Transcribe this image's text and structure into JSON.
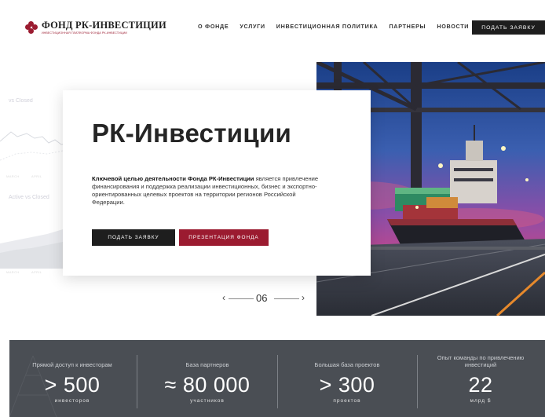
{
  "header": {
    "logo_title": "ФОНД РК-ИНВЕСТИЦИИ",
    "logo_subtitle": "ИНВЕСТИЦИОННАЯ ПЛАТФОРМА ФОНДА РК-ИНВЕСТИЦИИ",
    "nav": [
      "О ФОНДЕ",
      "УСЛУГИ",
      "ИНВЕСТИЦИОННАЯ ПОЛИТИКА",
      "ПАРТНЕРЫ",
      "НОВОСТИ"
    ],
    "apply_button": "ПОДАТЬ ЗАЯВКУ",
    "brand_color": "#9b1b30"
  },
  "background_dashboard": {
    "chart1_label": "vs Closed",
    "chart2_label": "Active vs Closed",
    "ticks": [
      "MARCH",
      "APRIL"
    ]
  },
  "hero": {
    "title": "РК-Инвестиции",
    "lead_bold": "Ключевой целью деятельности Фонда РК-Инвестиции",
    "lead_text": " является привлечение финансирования и поддержка реализации инвестиционных, бизнес и экспортно-ориентированных целевых проектов на территории регионов Российской Федерации.",
    "btn_apply": "ПОДАТЬ ЗАЯВКУ",
    "btn_presentation": "ПРЕЗЕНТАЦИЯ ФОНДА",
    "image": "cargo-ship-port-icon"
  },
  "slider": {
    "prev_icon": "chevron-left-icon",
    "next_icon": "chevron-right-icon",
    "current": "06"
  },
  "stats": [
    {
      "label": "Прямой доступ к инвесторам",
      "value": "> 500",
      "unit": "инвесторов"
    },
    {
      "label": "База партнеров",
      "value": "≈ 80 000",
      "unit": "участников"
    },
    {
      "label": "Большая база проектов",
      "value": "> 300",
      "unit": "проектов"
    },
    {
      "label": "Опыт команды по привлечению инвестиций",
      "value": "22",
      "unit": "млрд $"
    }
  ]
}
